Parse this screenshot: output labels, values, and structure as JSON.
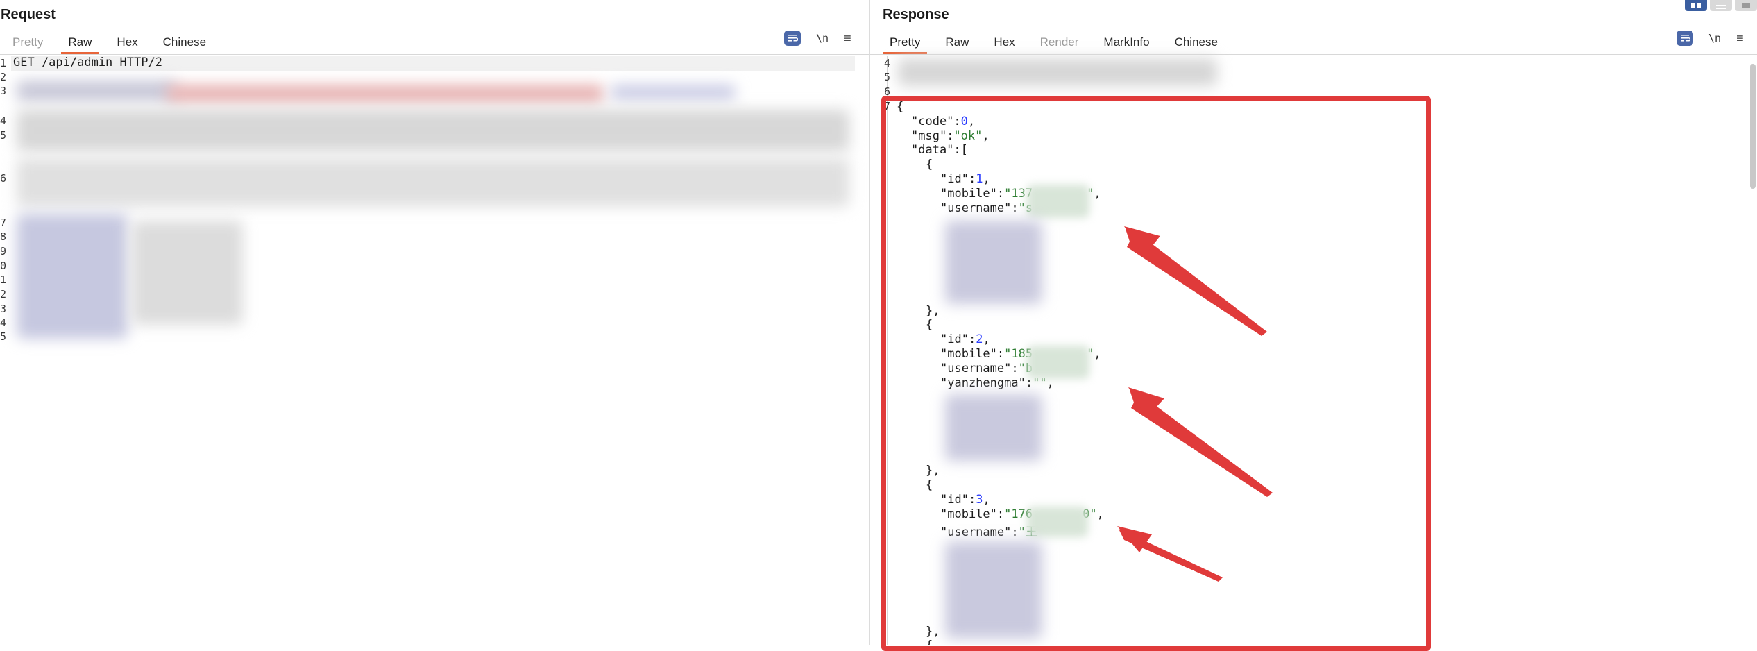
{
  "request": {
    "title": "Request",
    "tabs": [
      {
        "label": "Pretty",
        "state": "dim"
      },
      {
        "label": "Raw",
        "state": "active"
      },
      {
        "label": "Hex",
        "state": "normal"
      },
      {
        "label": "Chinese",
        "state": "normal"
      }
    ],
    "tools": {
      "newline": "\\n",
      "menu": "≡"
    },
    "line_numbers": [
      "1",
      "2",
      "3",
      "4",
      "5",
      "6",
      "7",
      "8",
      "9",
      "0",
      "1",
      "2",
      "3",
      "4",
      "5"
    ],
    "first_line": "GET /api/admin HTTP/2"
  },
  "response": {
    "title": "Response",
    "tabs": [
      {
        "label": "Pretty",
        "state": "active"
      },
      {
        "label": "Raw",
        "state": "normal"
      },
      {
        "label": "Hex",
        "state": "normal"
      },
      {
        "label": "Render",
        "state": "dim"
      },
      {
        "label": "MarkInfo",
        "state": "normal"
      },
      {
        "label": "Chinese",
        "state": "normal"
      }
    ],
    "tools": {
      "newline": "\\n",
      "menu": "≡"
    },
    "line_numbers": [
      "4",
      "5",
      "6",
      "7"
    ],
    "json": {
      "open": "{",
      "code_key": "\"code\"",
      "code_val": "0",
      "msg_key": "\"msg\"",
      "msg_val": "\"ok\"",
      "data_key": "\"data\"",
      "data_open": "[",
      "item_open": "{",
      "item_close": "},",
      "id_key": "\"id\"",
      "mobile_key": "\"mobile\"",
      "username_key": "\"username\"",
      "yanzhengma_key": "\"yanzhengma\"",
      "yanzhengma_val": "\"\"",
      "items": [
        {
          "id": "1",
          "mobile_prefix": "\"137",
          "mobile_suffix": "\"",
          "username_prefix": "\"s"
        },
        {
          "id": "2",
          "mobile_prefix": "\"185",
          "mobile_suffix": "\"",
          "username_prefix": "\"b"
        },
        {
          "id": "3",
          "mobile_prefix": "\"176",
          "mobile_suffix": "0\"",
          "username_prefix": "\"王"
        }
      ]
    }
  },
  "colors": {
    "accent_tab": "#e8653a",
    "highlight": "#e03a3a",
    "json_number": "#2a3cff",
    "json_string": "#2e7d32"
  }
}
